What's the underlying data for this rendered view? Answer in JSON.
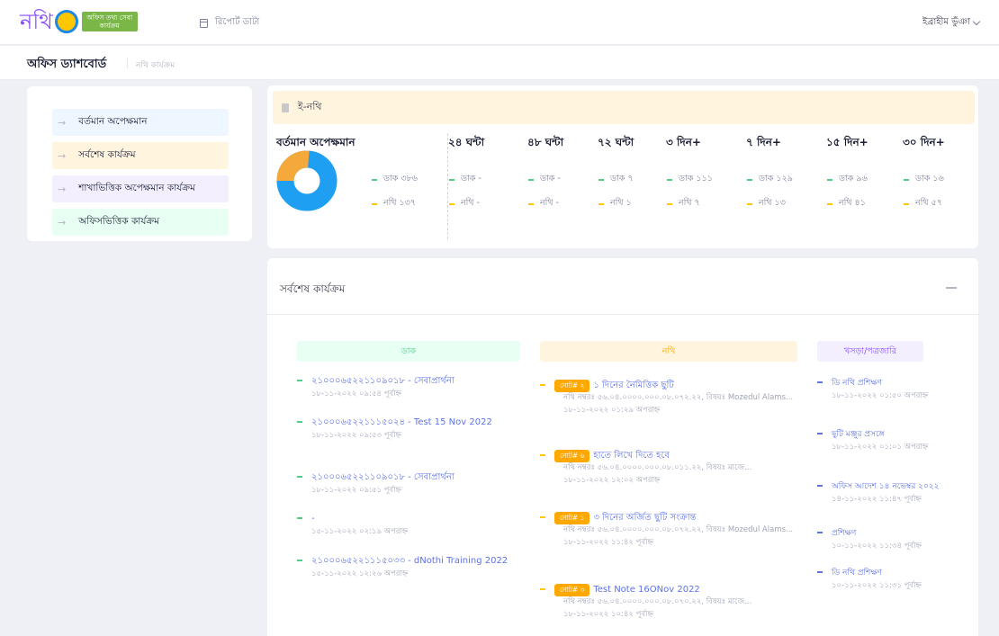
{
  "colors": {
    "dak": "#50cd89",
    "nothi": "#ffc700",
    "donut_blue": "#1e9ff2",
    "donut_orange": "#f6a93b",
    "link": "#5e72e4",
    "badge": "#ffa800",
    "purple": "#8950fc"
  },
  "header": {
    "logo_text": "নথি",
    "logo_badge": "অফিস তথ্য সেবা কার্যক্রম",
    "report_label": "রিপোর্ট ডাটা",
    "user_name": "ইব্রাহীম ভুঁঞা"
  },
  "subheader": {
    "title": "অফিস ড্যাশবোর্ড",
    "crumb": "নথি কার্যক্রম"
  },
  "sidebar": {
    "items": [
      {
        "label": "বর্তমান অপেক্ষমান",
        "bg": "#eef6ff"
      },
      {
        "label": "সর্বশেষ কার্যক্রম",
        "bg": "#fff4de"
      },
      {
        "label": "শাখাভিত্তিক অপেক্ষমান কার্যক্রম",
        "bg": "#f3efff"
      },
      {
        "label": "অফিসভিত্তিক কার্যক্রম",
        "bg": "#e8fff3"
      }
    ]
  },
  "enothi": {
    "title": "ই-নথি",
    "current": {
      "title": "বর্তমান অপেক্ষমান",
      "dak": "ডাক ৩৮৬",
      "nothi": "নথি ১৩৭",
      "dak_count": 386,
      "nothi_count": 137
    },
    "columns": [
      {
        "title": "২৪ ঘন্টা",
        "dak": "ডাক -",
        "nothi": "নথি -"
      },
      {
        "title": "৪৮ ঘন্টা",
        "dak": "ডাক -",
        "nothi": "নথি -"
      },
      {
        "title": "৭২ ঘন্টা",
        "dak": "ডাক ৭",
        "nothi": "নথি ১"
      },
      {
        "title": "৩ দিন+",
        "dak": "ডাক ১১১",
        "nothi": "নথি ৭"
      },
      {
        "title": "৭ দিন+",
        "dak": "ডাক ১২৯",
        "nothi": "নথি ১৩"
      },
      {
        "title": "১৫ দিন+",
        "dak": "ডাক ৯৬",
        "nothi": "নথি ৪১"
      },
      {
        "title": "৩০ দিন+",
        "dak": "ডাক ১৬",
        "nothi": "নথি ৫৭"
      }
    ]
  },
  "activity": {
    "title": "সর্বশেষ কার্যক্রম",
    "col_dak": "ডাক",
    "col_nothi": "নথি",
    "col_potro": "খসড়া/পত্রজারি",
    "dak": [
      {
        "text": "২১০০০৬৫২২১১০৯০১৮ - সেবাপ্রার্থনা",
        "meta": "১৮-১১-২০২২ ০৯:৫৪ পূর্বাহ্ন"
      },
      {
        "text": "২১০০০৬৫২২১১১৫০২৪ - Test 15 Nov 2022",
        "meta": "১৮-১১-২০২২ ০৯:৫৩ পূর্বাহ্ন"
      },
      {
        "text": "২১০০০৬৫২২১১০৯০১৮ - সেবাপ্রার্থনা",
        "meta": "১৮-১১-২০২২ ০৯:৫১ পূর্বাহ্ন"
      },
      {
        "text": "-",
        "meta": "১৫-১১-২০২২ ০২:১৯ অপরাহ্ন"
      },
      {
        "text": "২১০০০৬৫২২১১১৫০৩৩ - dNothi Training 2022",
        "meta": "১৫-১১-২০২২ ১২:২৬ অপরাহ্ন"
      }
    ],
    "nothi": [
      {
        "badge": "নোট# ২",
        "title": "১ দিনের নৈমিত্তিক ছুটি",
        "desc": "নথি নম্বরঃ ৫৬.০৪.০০০০.০০০.০৮.০৭২.২২, বিষয়ঃ Mozedul Alams...",
        "meta": "১৮-১১-২০২২ ০১:২৯ অপরাহ্ন"
      },
      {
        "badge": "নোট# ৬",
        "title": "হাতে লিখে দিতে হবে",
        "desc": "নথি নম্বরঃ ৫৬.০৪.০০০০.০০০.০৮.০১১.২২, বিষয়ঃ মাজে...",
        "meta": "১৮-১১-২০২২ ১২:০২ অপরাহ্ন"
      },
      {
        "badge": "নোট# ১",
        "title": "৩ দিনের অর্জিত ছুটি সংক্রান্ত",
        "desc": "নথি নম্বরঃ ৫৬.০৪.০০০০.০০০.০৮.০৭২.২২, বিষয়ঃ Mozedul Alams...",
        "meta": "১৮-১১-২০২২ ১১:৪২ পূর্বাহ্ন"
      },
      {
        "badge": "নোট# ৩",
        "title": "Test Note 16ONov 2022",
        "desc": "নথি নম্বরঃ ৫৬.০৪.০০০০.০০০.০৮.০৭০.২২, বিষয়ঃ মাজে...",
        "meta": "১৮-১১-২০২২ ১০:৪২ পূর্বাহ্ন"
      }
    ],
    "potro": [
      {
        "text": "ডি নথি প্রশিক্ষণ",
        "meta": "১৮-১১-২০২২ ০১:৫০ অপরাহ্ন"
      },
      {
        "text": "ছুটি মঞ্জুর প্রসঙ্গে",
        "meta": "১৮-১১-২০২২ ০১:০১ অপরাহ্ন"
      },
      {
        "text": "অফিস আদেশ ১৪ নভেম্বর ২০২২",
        "meta": "১৪-১১-২০২২ ১১:৪৭ পূর্বাহ্ন"
      },
      {
        "text": "প্রশিক্ষণ",
        "meta": "১০-১১-২০২২ ১১:৩৪ পূর্বাহ্ন"
      },
      {
        "text": "ডি নথি প্রশিক্ষণ",
        "meta": "১০-১১-২০২২ ১১:৩১ পূর্বাহ্ন"
      }
    ]
  }
}
